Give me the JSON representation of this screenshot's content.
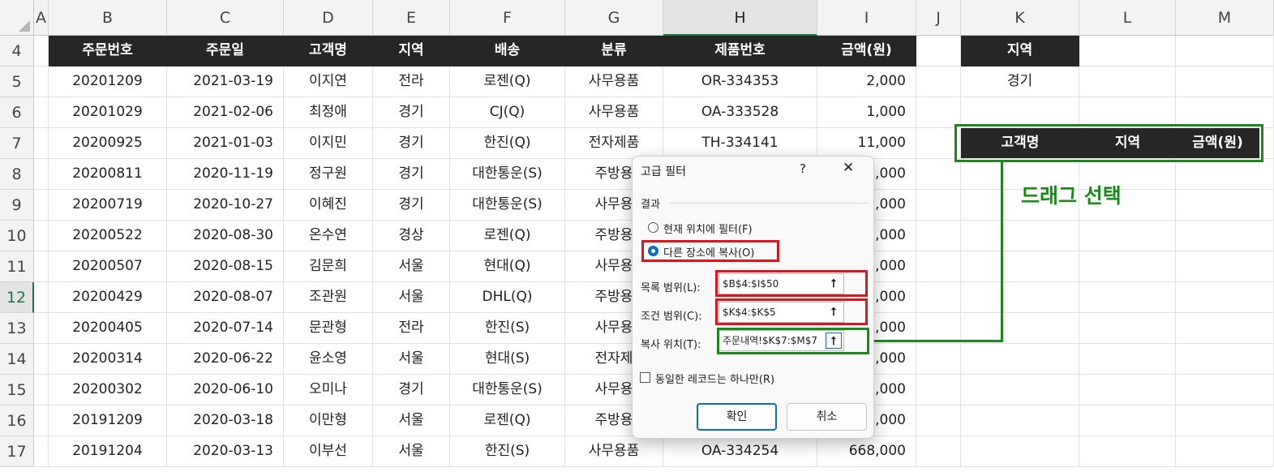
{
  "columns": [
    {
      "id": "A",
      "label": "A"
    },
    {
      "id": "B",
      "label": "B"
    },
    {
      "id": "C",
      "label": "C"
    },
    {
      "id": "D",
      "label": "D"
    },
    {
      "id": "E",
      "label": "E"
    },
    {
      "id": "F",
      "label": "F"
    },
    {
      "id": "G",
      "label": "G"
    },
    {
      "id": "H",
      "label": "H"
    },
    {
      "id": "I",
      "label": "I"
    },
    {
      "id": "J",
      "label": "J"
    },
    {
      "id": "K",
      "label": "K"
    },
    {
      "id": "L",
      "label": "L"
    },
    {
      "id": "M",
      "label": "M"
    }
  ],
  "selected_column": "H",
  "selected_row": "12",
  "row_numbers": [
    "4",
    "5",
    "6",
    "7",
    "8",
    "9",
    "10",
    "11",
    "12",
    "13",
    "14",
    "15",
    "16",
    "17"
  ],
  "table": {
    "headers": [
      "주문번호",
      "주문일",
      "고객명",
      "지역",
      "배송",
      "분류",
      "제품번호",
      "금액(원)"
    ],
    "rows": [
      [
        "20201209",
        "2021-03-19",
        "이지연",
        "전라",
        "로젠(Q)",
        "사무용품",
        "OR-334353",
        "2,000"
      ],
      [
        "20201029",
        "2021-02-06",
        "최정애",
        "경기",
        "CJ(Q)",
        "사무용품",
        "OA-333528",
        "1,000"
      ],
      [
        "20200925",
        "2021-01-03",
        "이지민",
        "경기",
        "한진(Q)",
        "전자제품",
        "TH-334141",
        "11,000"
      ],
      [
        "20200811",
        "2020-11-19",
        "정구원",
        "경기",
        "대한통운(S)",
        "주방용",
        "",
        ",000"
      ],
      [
        "20200719",
        "2020-10-27",
        "이혜진",
        "경기",
        "대한통운(S)",
        "사무용",
        "",
        ",000"
      ],
      [
        "20200522",
        "2020-08-30",
        "온수연",
        "경상",
        "로젠(Q)",
        "주방용",
        "",
        ",000"
      ],
      [
        "20200507",
        "2020-08-15",
        "김문희",
        "서울",
        "현대(Q)",
        "사무용",
        "",
        ",000"
      ],
      [
        "20200429",
        "2020-08-07",
        "조관원",
        "서울",
        "DHL(Q)",
        "주방용",
        "",
        ",000"
      ],
      [
        "20200405",
        "2020-07-14",
        "문관형",
        "전라",
        "한진(S)",
        "사무용",
        "",
        ",000"
      ],
      [
        "20200314",
        "2020-06-22",
        "윤소영",
        "서울",
        "현대(S)",
        "전자제",
        "",
        ",000"
      ],
      [
        "20200302",
        "2020-06-10",
        "오미나",
        "경기",
        "대한통운(S)",
        "사무용",
        "",
        ",000"
      ],
      [
        "20191209",
        "2020-03-18",
        "이만형",
        "서울",
        "로젠(Q)",
        "주방용",
        "",
        ",000"
      ],
      [
        "20191204",
        "2020-03-13",
        "이부선",
        "서울",
        "한진(S)",
        "사무용품",
        "OA-334254",
        "668,000"
      ]
    ]
  },
  "criteria": {
    "header": "지역",
    "value": "경기"
  },
  "copy_headers": [
    "고객명",
    "지역",
    "금액(원)"
  ],
  "annotation": {
    "drag_label": "드래그 선택"
  },
  "dialog": {
    "title": "고급 필터",
    "help": "?",
    "close": "✕",
    "section": "결과",
    "option1": "현재 위치에 필터(F)",
    "option2": "다른 장소에 복사(O)",
    "selected_option": 2,
    "list_range_label": "목록 범위(L):",
    "list_range_value": "$B$4:$I$50",
    "criteria_range_label": "조건 범위(C):",
    "criteria_range_value": "$K$4:$K$5",
    "copy_to_label": "복사 위치(T):",
    "copy_to_value": "주문내역!$K$7:$M$7",
    "unique_label": "동일한 레코드는 하나만(R)",
    "unique_checked": false,
    "ok": "확인",
    "cancel": "취소",
    "picker_icon": "⭡"
  },
  "colors": {
    "header_fill": "#262626",
    "highlight_red": "#e0141c",
    "highlight_green": "#1a8a1a",
    "accent": "#0f6cbd"
  }
}
